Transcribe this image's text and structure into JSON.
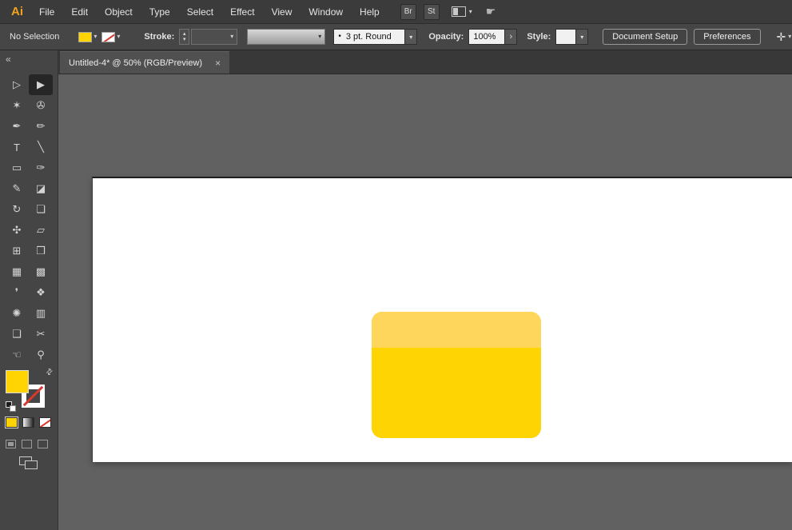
{
  "colors": {
    "accent_yellow": "#ffd402",
    "logo_orange": "#f2a21e",
    "none_red": "#d83a30"
  },
  "menubar": {
    "logo": "Ai",
    "items": [
      "File",
      "Edit",
      "Object",
      "Type",
      "Select",
      "Effect",
      "View",
      "Window",
      "Help"
    ],
    "bridge_button": "Br",
    "stock_button": "St"
  },
  "icons": {
    "caret_down": "▾",
    "stepper_up": "▴",
    "stepper_down": "▾",
    "chevron_right": "›",
    "collapse_left": "«",
    "close": "×",
    "brush_dot": "•",
    "swap": "⇄",
    "transform": "✛",
    "touch": "☛"
  },
  "controlbar": {
    "selection_status": "No Selection",
    "stroke_label": "Stroke:",
    "brush_value": "3 pt. Round",
    "opacity_label": "Opacity:",
    "opacity_value": "100%",
    "style_label": "Style:",
    "document_setup_button": "Document Setup",
    "preferences_button": "Preferences"
  },
  "tabbar": {
    "tab_title": "Untitled-4* @ 50% (RGB/Preview)"
  },
  "toolbar": {
    "tools": [
      {
        "name": "direct-selection",
        "glyph": "▷",
        "selected": false
      },
      {
        "name": "selection",
        "glyph": "▶",
        "selected": true
      },
      {
        "name": "magic-wand",
        "glyph": "✶",
        "selected": false
      },
      {
        "name": "lasso",
        "glyph": "✇",
        "selected": false
      },
      {
        "name": "pen",
        "glyph": "✒",
        "selected": false
      },
      {
        "name": "curvature",
        "glyph": "✏",
        "selected": false
      },
      {
        "name": "type",
        "glyph": "T",
        "selected": false
      },
      {
        "name": "line-segment",
        "glyph": "╲",
        "selected": false
      },
      {
        "name": "rectangle",
        "glyph": "▭",
        "selected": false
      },
      {
        "name": "paintbrush",
        "glyph": "✑",
        "selected": false
      },
      {
        "name": "pencil",
        "glyph": "✎",
        "selected": false
      },
      {
        "name": "eraser",
        "glyph": "◪",
        "selected": false
      },
      {
        "name": "rotate",
        "glyph": "↻",
        "selected": false
      },
      {
        "name": "scale",
        "glyph": "❏",
        "selected": false
      },
      {
        "name": "width",
        "glyph": "✣",
        "selected": false
      },
      {
        "name": "free-transform",
        "glyph": "▱",
        "selected": false
      },
      {
        "name": "perspective-grid",
        "glyph": "⊞",
        "selected": false
      },
      {
        "name": "shape-builder",
        "glyph": "❒",
        "selected": false
      },
      {
        "name": "mesh",
        "glyph": "▦",
        "selected": false
      },
      {
        "name": "gradient",
        "glyph": "▩",
        "selected": false
      },
      {
        "name": "eyedropper",
        "glyph": "❜",
        "selected": false
      },
      {
        "name": "blend",
        "glyph": "❖",
        "selected": false
      },
      {
        "name": "symbol-sprayer",
        "glyph": "✺",
        "selected": false
      },
      {
        "name": "column-graph",
        "glyph": "▥",
        "selected": false
      },
      {
        "name": "artboard",
        "glyph": "❑",
        "selected": false
      },
      {
        "name": "slice",
        "glyph": "✂",
        "selected": false
      },
      {
        "name": "hand",
        "glyph": "☜",
        "selected": false
      },
      {
        "name": "zoom",
        "glyph": "⚲",
        "selected": false
      }
    ]
  },
  "canvas": {
    "artboard_color": "#ffffff",
    "shape": {
      "type": "rounded-rectangle",
      "top_color": "#ffd65c",
      "body_color": "#fed402"
    }
  }
}
